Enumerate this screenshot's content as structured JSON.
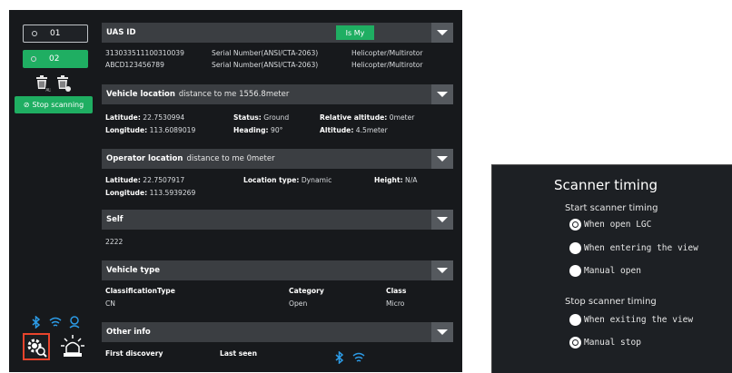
{
  "devices": [
    {
      "label": "01",
      "selected": false
    },
    {
      "label": "02",
      "selected": true
    }
  ],
  "stop_scanning": {
    "icon": "stop-circle-icon",
    "label": "Stop scanning"
  },
  "uas": {
    "title": "UAS ID",
    "is_my": "Is My",
    "rows": [
      {
        "id": "313033511100310039",
        "serial": "Serial Number(ANSI/CTA-2063)",
        "type": "Helicopter/Multirotor"
      },
      {
        "id": "ABCD123456789",
        "serial": "Serial Number(ANSI/CTA-2063)",
        "type": "Helicopter/Multirotor"
      }
    ]
  },
  "vehicle_location": {
    "title": "Vehicle location",
    "subtitle": "distance to me 1556.8meter",
    "latitude_label": "Latitude:",
    "latitude": "22.7530994",
    "longitude_label": "Longitude:",
    "longitude": "113.6089019",
    "status_label": "Status:",
    "status": "Ground",
    "heading_label": "Heading:",
    "heading": "90°",
    "rel_alt_label": "Relative altitude:",
    "rel_alt": "0meter",
    "alt_label": "Altitude:",
    "alt": "4.5meter"
  },
  "operator_location": {
    "title": "Operator location",
    "subtitle": "distance to me 0meter",
    "latitude_label": "Latitude:",
    "latitude": "22.7507917",
    "longitude_label": "Longitude:",
    "longitude": "113.5939269",
    "loc_type_label": "Location type:",
    "loc_type": "Dynamic",
    "height_label": "Height:",
    "height": "N/A"
  },
  "self": {
    "title": "Self",
    "value": "2222"
  },
  "vehicle_type": {
    "title": "Vehicle type",
    "classification_label": "ClassificationType",
    "classification": "CN",
    "category_label": "Category",
    "category": "Open",
    "class_label": "Class",
    "class": "Micro"
  },
  "other_info": {
    "title": "Other info",
    "first_discovery_label": "First discovery",
    "last_seen_label": "Last seen"
  },
  "scanner": {
    "title": "Scanner timing",
    "ghost_text": "...",
    "start_title": "Start scanner timing",
    "start_options": [
      "When open LGC",
      "When entering the view",
      "Manual open"
    ],
    "start_selected": 0,
    "stop_title": "Stop scanner timing",
    "stop_options": [
      "When exiting the view",
      "Manual stop"
    ],
    "stop_selected": 1
  },
  "colors": {
    "accent": "#1fae62",
    "panel": "#17191c",
    "header": "#3b3e42",
    "icon_blue": "#2c9be6",
    "selected_tool": "#e8442c"
  }
}
